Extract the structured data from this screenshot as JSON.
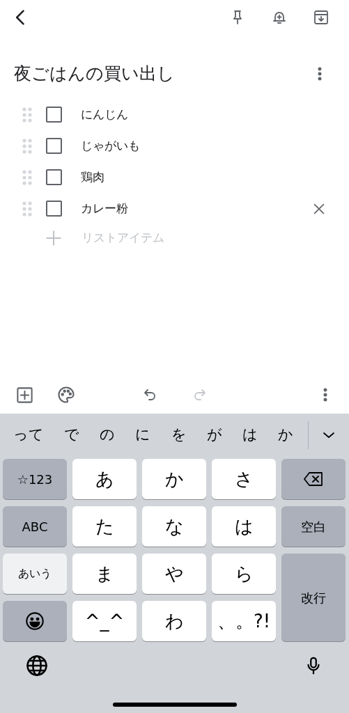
{
  "note": {
    "title": "夜ごはんの買い出し",
    "items": [
      {
        "text": "にんじん",
        "checked": false,
        "focused": false
      },
      {
        "text": "じゃがいも",
        "checked": false,
        "focused": false
      },
      {
        "text": "鶏肉",
        "checked": false,
        "focused": false
      },
      {
        "text": "カレー粉",
        "checked": false,
        "focused": true
      }
    ],
    "add_item": {
      "placeholder": "リストアイテム"
    }
  },
  "toolbar": {
    "undo_disabled": false,
    "redo_disabled": true
  },
  "keyboard": {
    "suggestions": [
      "って",
      "で",
      "の",
      "に",
      "を",
      "が",
      "は",
      "か"
    ],
    "keys": [
      {
        "kind": "mode",
        "label": "☆123",
        "selected": false
      },
      {
        "kind": "char",
        "label": "あ"
      },
      {
        "kind": "char",
        "label": "か"
      },
      {
        "kind": "char",
        "label": "さ"
      },
      {
        "kind": "backspace"
      },
      {
        "kind": "mode",
        "label": "ABC",
        "selected": false
      },
      {
        "kind": "char",
        "label": "た"
      },
      {
        "kind": "char",
        "label": "な"
      },
      {
        "kind": "char",
        "label": "は"
      },
      {
        "kind": "function",
        "label": "空白"
      },
      {
        "kind": "mode",
        "label": "あいう",
        "selected": true
      },
      {
        "kind": "char",
        "label": "ま"
      },
      {
        "kind": "char",
        "label": "や"
      },
      {
        "kind": "char",
        "label": "ら"
      },
      {
        "kind": "return",
        "label": "改行"
      },
      {
        "kind": "emoji"
      },
      {
        "kind": "char",
        "label": "^_^"
      },
      {
        "kind": "char",
        "label": "わ"
      },
      {
        "kind": "char",
        "label": "、。?!"
      }
    ]
  }
}
